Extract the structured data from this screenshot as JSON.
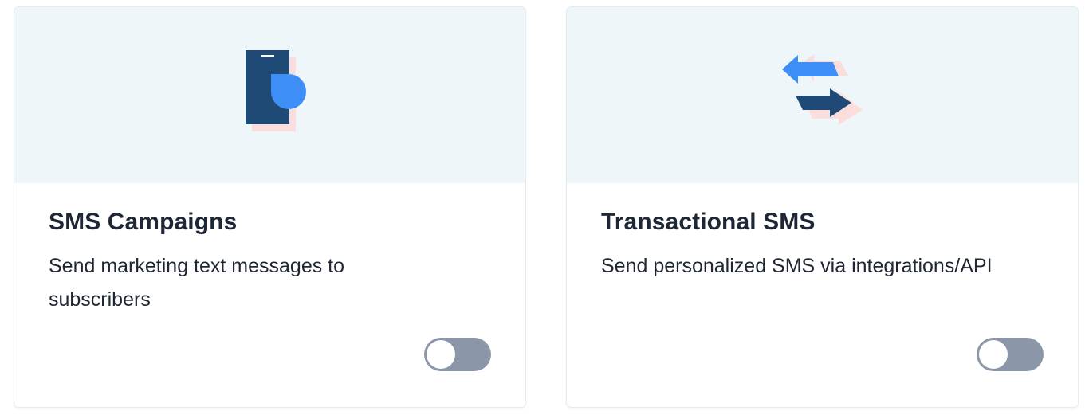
{
  "cards": [
    {
      "title": "SMS Campaigns",
      "description": "Send marketing text messages to subscribers",
      "icon": "phone-chat-icon",
      "toggle_enabled": false
    },
    {
      "title": "Transactional SMS",
      "description": "Send personalized SMS via integrations/API",
      "icon": "swap-arrows-icon",
      "toggle_enabled": false
    }
  ],
  "colors": {
    "hero_background": "#eff6f9",
    "navy": "#1f4a76",
    "blue": "#3d8ef7",
    "pink_shadow": "#fbdedb",
    "toggle_off": "#8b97a8",
    "title_text": "#1e2735"
  }
}
